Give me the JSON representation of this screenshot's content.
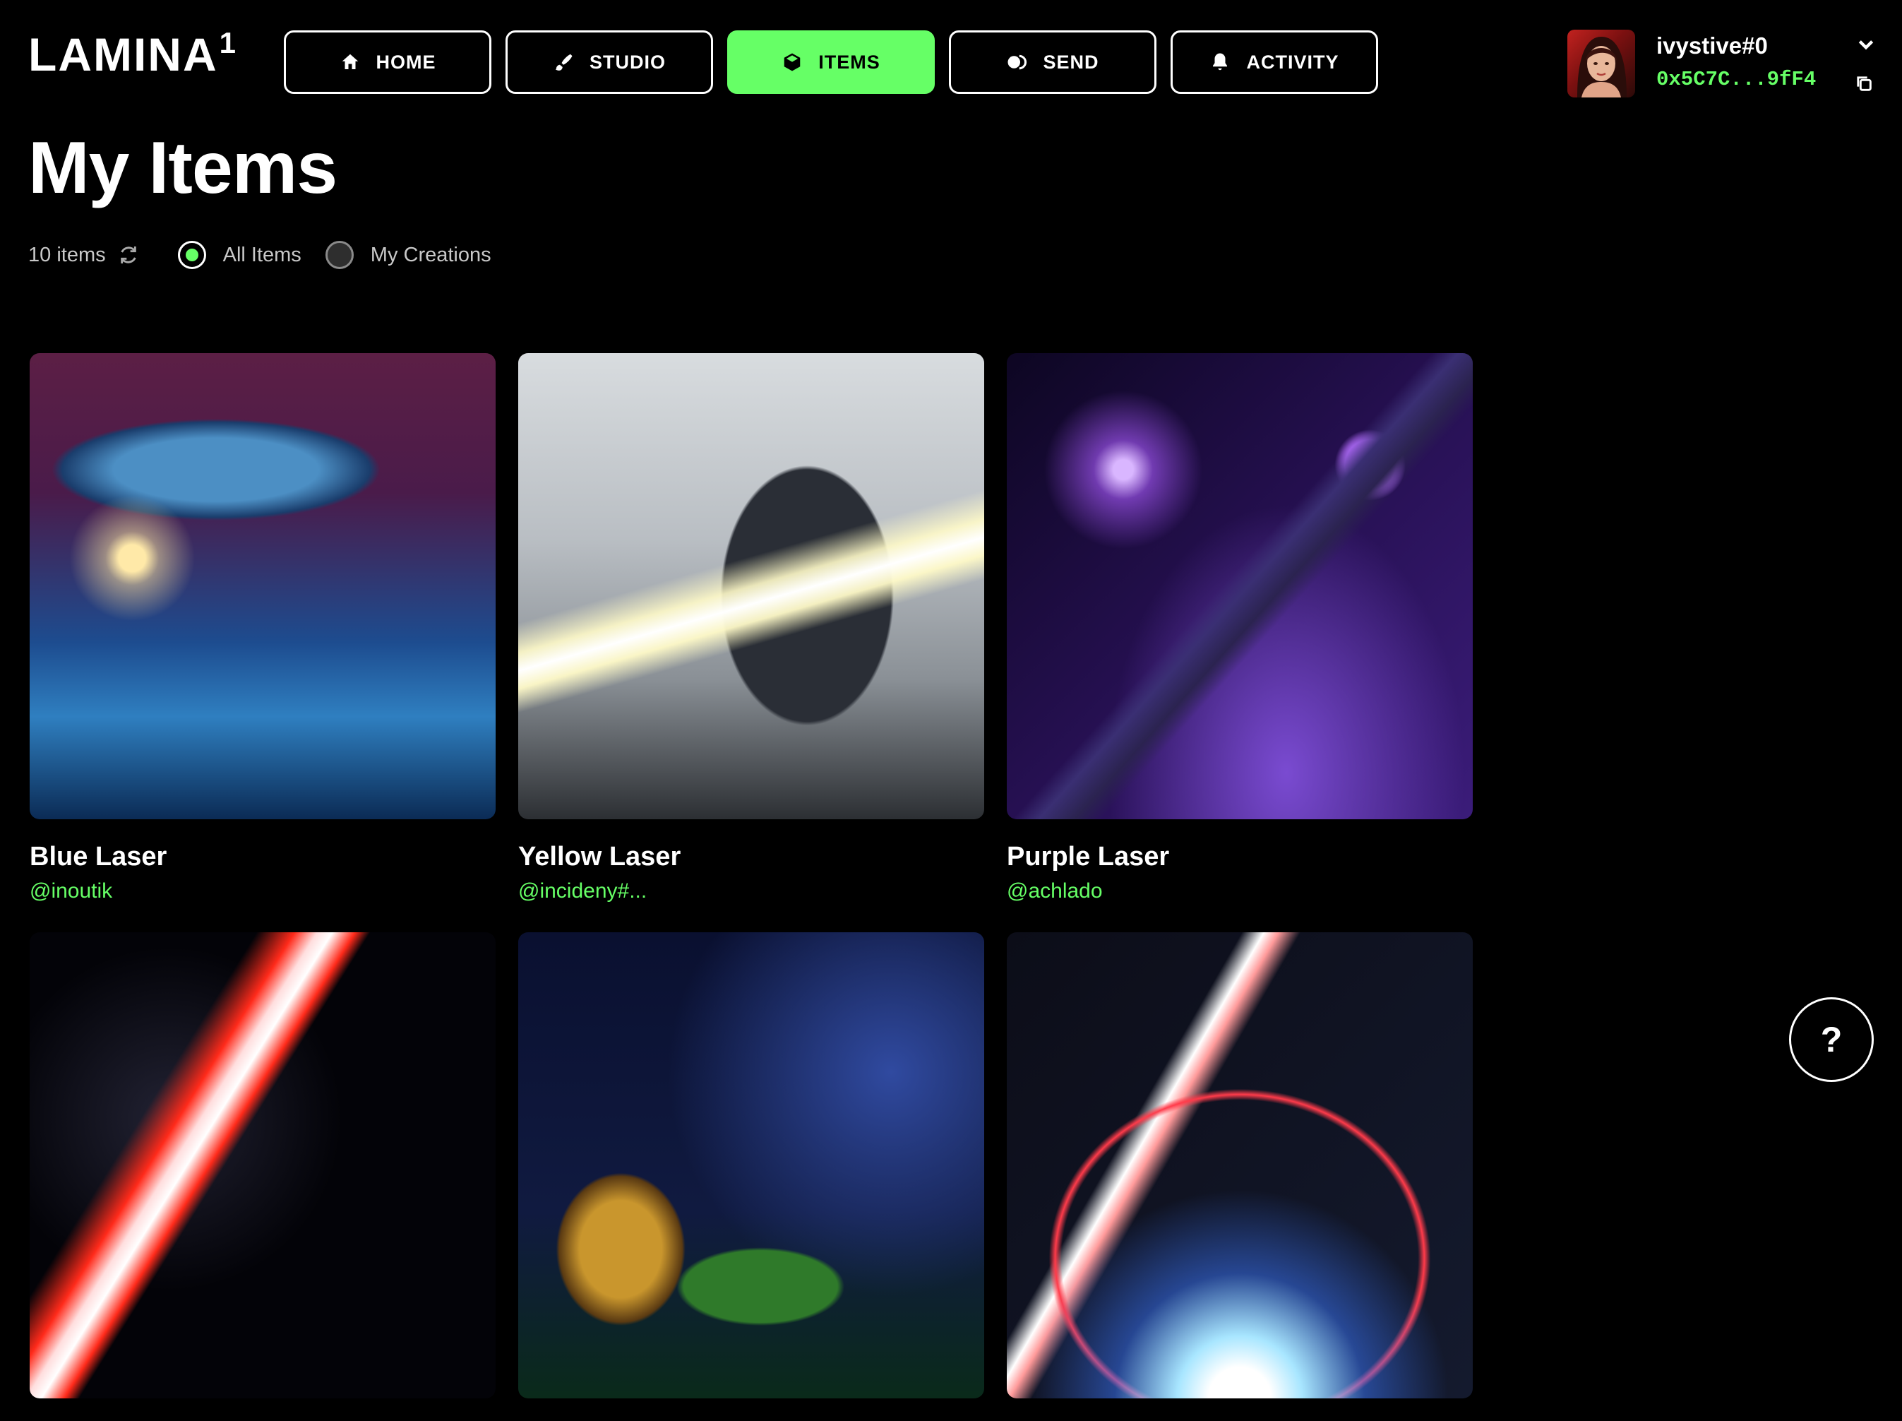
{
  "brand": {
    "name": "LAMINA",
    "mark": "1"
  },
  "nav": [
    {
      "label": "HOME",
      "icon": "home-icon",
      "active": false
    },
    {
      "label": "STUDIO",
      "icon": "brush-icon",
      "active": false
    },
    {
      "label": "ITEMS",
      "icon": "cube-icon",
      "active": true
    },
    {
      "label": "SEND",
      "icon": "send-icon",
      "active": false
    },
    {
      "label": "ACTIVITY",
      "icon": "bell-icon",
      "active": false
    }
  ],
  "account": {
    "username": "ivystive#0",
    "address": "0x5C7C...9fF4"
  },
  "page": {
    "title": "My Items"
  },
  "filters": {
    "count": "10 items",
    "options": [
      {
        "label": "All Items",
        "selected": true
      },
      {
        "label": "My Creations",
        "selected": false
      }
    ]
  },
  "items": [
    {
      "title": "Blue Laser",
      "creator": "@inoutik"
    },
    {
      "title": "Yellow Laser",
      "creator": "@incideny#..."
    },
    {
      "title": "Purple Laser",
      "creator": "@achlado"
    },
    {
      "title": "",
      "creator": ""
    },
    {
      "title": "",
      "creator": ""
    },
    {
      "title": "",
      "creator": ""
    }
  ],
  "help": {
    "label": "?"
  },
  "colors": {
    "accent": "#66ff66",
    "background": "#000000",
    "text": "#ffffff"
  }
}
